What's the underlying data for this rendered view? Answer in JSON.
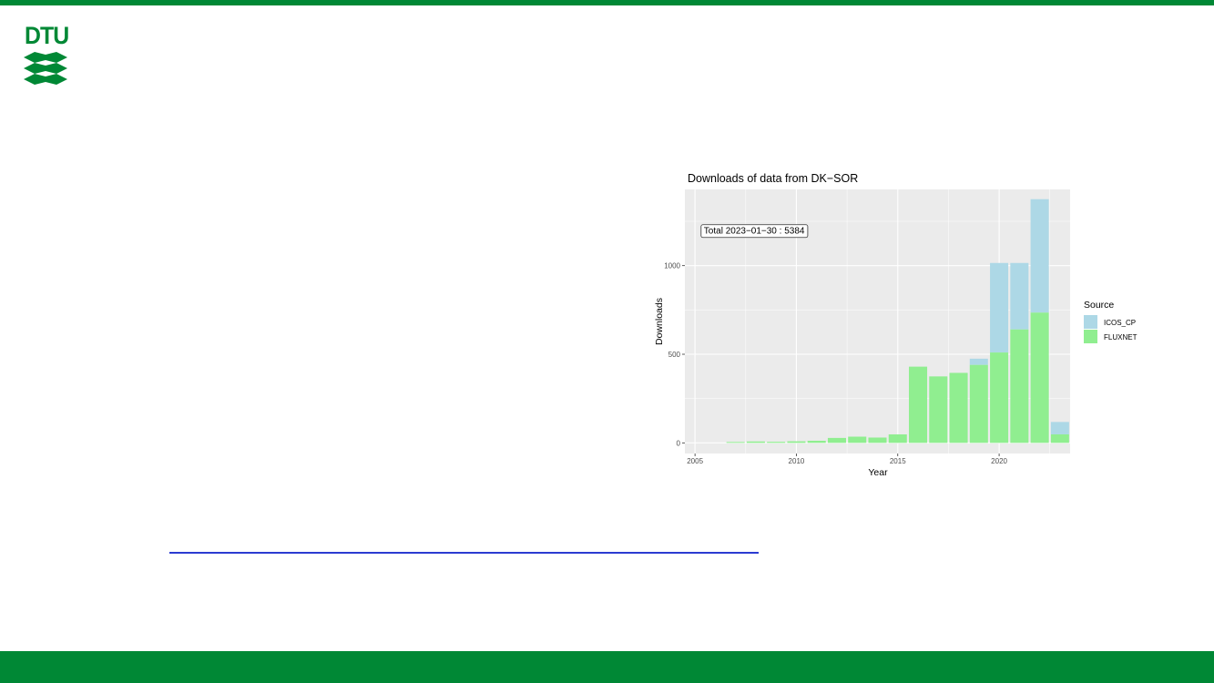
{
  "colors": {
    "brand_green": "#008835",
    "link_blue": "#2b3bd1",
    "panel_bg": "#ebebeb",
    "grid": "#ffffff",
    "icos": "#add8e6",
    "fluxnet": "#90ee90"
  },
  "logo": {
    "text": "DTU"
  },
  "chart_data": {
    "type": "bar",
    "stacked": true,
    "title": "Downloads of data from DK−SOR",
    "xlabel": "Year",
    "ylabel": "Downloads",
    "xlim": [
      2004.5,
      2023.5
    ],
    "ylim": [
      -60,
      1430
    ],
    "x_ticks": [
      2005,
      2010,
      2015,
      2020
    ],
    "y_ticks": [
      0,
      500,
      1000
    ],
    "grid": true,
    "annotation": {
      "text": "Total 2023−01−30 : 5384",
      "x": 2005.3,
      "y": 1200
    },
    "legend": {
      "title": "Source",
      "position": "right",
      "entries": [
        {
          "name": "ICOS_CP",
          "color": "#add8e6"
        },
        {
          "name": "FLUXNET",
          "color": "#90ee90"
        }
      ]
    },
    "x": [
      2007,
      2008,
      2009,
      2010,
      2011,
      2012,
      2013,
      2014,
      2015,
      2016,
      2017,
      2018,
      2019,
      2020,
      2021,
      2022,
      2023
    ],
    "series": [
      {
        "name": "FLUXNET",
        "values": [
          5,
          8,
          6,
          9,
          12,
          28,
          35,
          30,
          48,
          430,
          375,
          395,
          440,
          510,
          640,
          735,
          48
        ]
      },
      {
        "name": "ICOS_CP",
        "values": [
          0,
          0,
          0,
          0,
          0,
          0,
          0,
          0,
          0,
          0,
          0,
          0,
          35,
          505,
          375,
          640,
          70
        ]
      }
    ]
  }
}
